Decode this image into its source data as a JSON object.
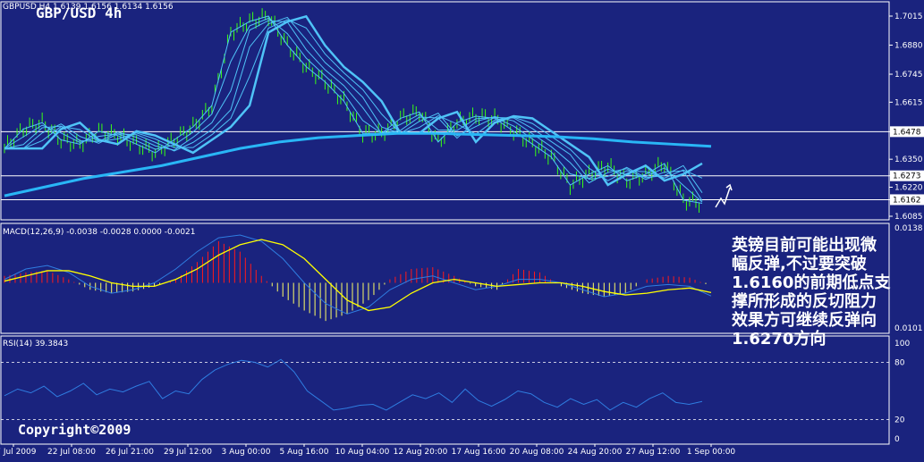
{
  "symbol_timeframe": "GBP/USD 4h",
  "ohlc_text": "GBPUSD,H4 1.6139 1.6156 1.6134 1.6156",
  "macd_label": "MACD(12,26,9) -0.0038 -0.0028 0.0000 -0.0021",
  "rsi_label": "RSI(14) 39.3843",
  "copyright": "Copyright©2009",
  "annotation_lines": [
    "英镑目前可能出现微",
    "幅反弹,不过要突破",
    "1.6160的前期低点支",
    "撑所形成的反切阻力",
    "效果方可继续反弹向",
    "1.6270方向"
  ],
  "colors": {
    "background": "#1a237e",
    "candles": "#39ff14",
    "ma": "#4fc3f7",
    "ma_thick": "#29b6f6",
    "macd_pos": "#ff1a1a",
    "macd_neg": "#ffff66",
    "signal": "#ffff00",
    "rsi": "#2f7de1",
    "gridline": "#ffffff"
  },
  "chart_data": [
    {
      "type": "line",
      "panel": "price",
      "y_ticks": [
        "1.7015",
        "1.6880",
        "1.6745",
        "1.6615",
        "1.6478",
        "1.6350",
        "1.6273",
        "1.6220",
        "1.6162",
        "1.6085"
      ],
      "ylim": [
        1.6085,
        1.7015
      ],
      "horizontal_levels": [
        1.6478,
        1.6273,
        1.6162
      ],
      "x_ticks": [
        "17 Jul 2009",
        "22 Jul 08:00",
        "26 Jul 21:00",
        "29 Jul 12:00",
        "3 Aug 00:00",
        "5 Aug 16:00",
        "10 Aug 04:00",
        "12 Aug 20:00",
        "17 Aug 16:00",
        "20 Aug 08:00",
        "24 Aug 20:00",
        "27 Aug 12:00",
        "1 Sep 00:00"
      ],
      "series": [
        {
          "values": [
            1.64,
            1.649,
            1.652,
            1.644,
            1.642,
            1.648,
            1.646,
            1.642,
            1.638,
            1.644,
            1.65,
            1.66,
            1.694,
            1.699,
            1.7015,
            1.688,
            1.678,
            1.671,
            1.662,
            1.647,
            1.647,
            1.654,
            1.657,
            1.643,
            1.652,
            1.655,
            1.654,
            1.648,
            1.642,
            1.636,
            1.623,
            1.628,
            1.632,
            1.625,
            1.628,
            1.633,
            1.616,
            1.6145
          ]
        },
        {
          "values": [
            1.618,
            1.622,
            1.626,
            1.629,
            1.632,
            1.636,
            1.64,
            1.643,
            1.645,
            1.646,
            1.647,
            1.647,
            1.6465,
            1.646,
            1.6455,
            1.6445,
            1.643,
            1.642,
            1.641
          ]
        }
      ]
    },
    {
      "type": "bar",
      "panel": "macd",
      "y_ticks": [
        "0.0138",
        "0.0101"
      ],
      "values": [
        0.002,
        0.003,
        0.0035,
        0.001,
        -0.002,
        -0.003,
        -0.0025,
        -0.001,
        0.001,
        0.006,
        0.012,
        0.009,
        0.002,
        -0.004,
        -0.008,
        -0.011,
        -0.009,
        -0.005,
        0.001,
        0.004,
        0.0045,
        0.002,
        -0.001,
        -0.002,
        0.004,
        0.003,
        -0.001,
        -0.003,
        -0.004,
        -0.003,
        0.001,
        0.002,
        0.0015,
        -0.001
      ],
      "macd_line": [
        0.001,
        0.004,
        0.005,
        0.003,
        -0.001,
        -0.003,
        -0.002,
        0.0,
        0.004,
        0.009,
        0.013,
        0.0138,
        0.012,
        0.007,
        0.0,
        -0.006,
        -0.009,
        -0.007,
        -0.002,
        0.001,
        0.002,
        0.0,
        -0.002,
        -0.001,
        0.001,
        0.001,
        0.0,
        -0.002,
        -0.004,
        -0.003,
        -0.001,
        -0.0005,
        -0.001,
        -0.0038
      ],
      "signal_line": [
        0.0005,
        0.002,
        0.0035,
        0.0035,
        0.002,
        0.0,
        -0.001,
        -0.001,
        0.001,
        0.004,
        0.008,
        0.011,
        0.0125,
        0.011,
        0.007,
        0.001,
        -0.005,
        -0.008,
        -0.007,
        -0.003,
        0.0,
        0.001,
        0.0,
        -0.001,
        -0.0005,
        0.0,
        0.0,
        -0.001,
        -0.0025,
        -0.0035,
        -0.003,
        -0.002,
        -0.0015,
        -0.0028
      ]
    },
    {
      "type": "line",
      "panel": "rsi",
      "y_ticks": [
        "100",
        "80",
        "20",
        "0"
      ],
      "ylim": [
        0,
        100
      ],
      "levels": [
        80,
        20
      ],
      "values": [
        45,
        52,
        48,
        55,
        44,
        50,
        58,
        46,
        52,
        49,
        55,
        60,
        42,
        50,
        47,
        62,
        72,
        78,
        82,
        80,
        75,
        83,
        70,
        50,
        40,
        30,
        32,
        35,
        36,
        30,
        38,
        46,
        42,
        48,
        38,
        52,
        40,
        34,
        41,
        50,
        47,
        38,
        33,
        42,
        36,
        41,
        30,
        38,
        33,
        42,
        48,
        38,
        36,
        39
      ]
    }
  ]
}
